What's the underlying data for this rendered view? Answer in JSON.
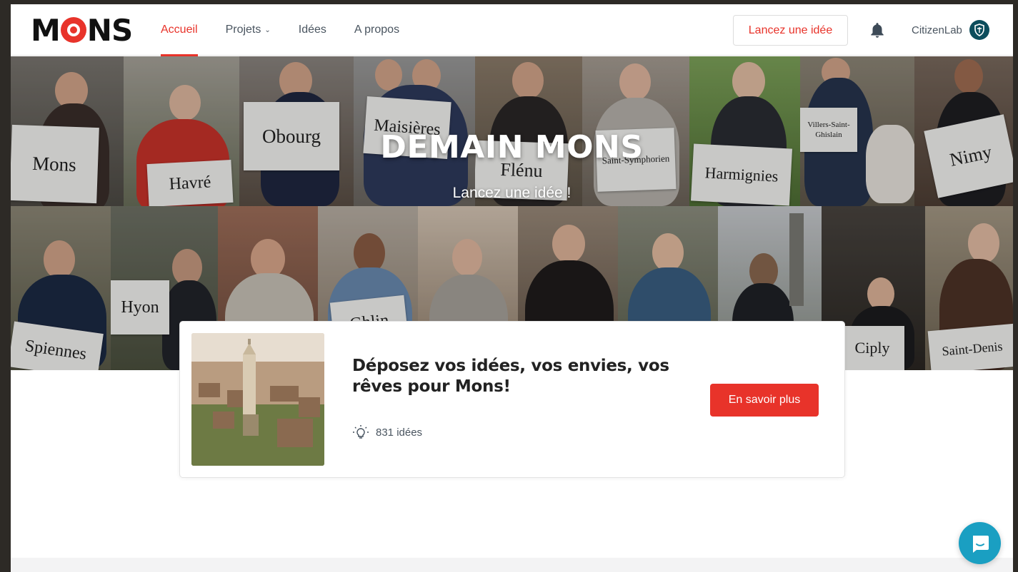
{
  "logo": {
    "text_left": "M",
    "text_right": "NS"
  },
  "nav": {
    "items": [
      {
        "label": "Accueil",
        "active": true
      },
      {
        "label": "Projets",
        "has_dropdown": true
      },
      {
        "label": "Idées"
      },
      {
        "label": "A propos"
      }
    ]
  },
  "header": {
    "cta_label": "Lancez une idée",
    "user_name": "CitizenLab"
  },
  "hero": {
    "title": "DEMAIN MONS",
    "subtitle": "Lancez une idée !",
    "signs": [
      "Mons",
      "Havré",
      "Obourg",
      "Maisières",
      "Flénu",
      "Saint-Symphorien",
      "Harmignies",
      "Villers-Saint-Ghislain",
      "Nimy",
      "Spiennes",
      "Hyon",
      "Ghlin",
      "Ciply",
      "Saint-Denis"
    ]
  },
  "project_card": {
    "title": "Déposez vos idées, vos envies, vos rêves pour Mons!",
    "ideas_count": "831 idées",
    "button_label": "En savoir plus"
  },
  "colors": {
    "accent": "#e8332a",
    "text": "#4a5560",
    "avatar": "#0c4d5c",
    "chat": "#1a9fc2"
  },
  "icons": [
    "bell-icon",
    "shield-icon",
    "lightbulb-icon",
    "chevron-down-icon",
    "chat-icon"
  ]
}
